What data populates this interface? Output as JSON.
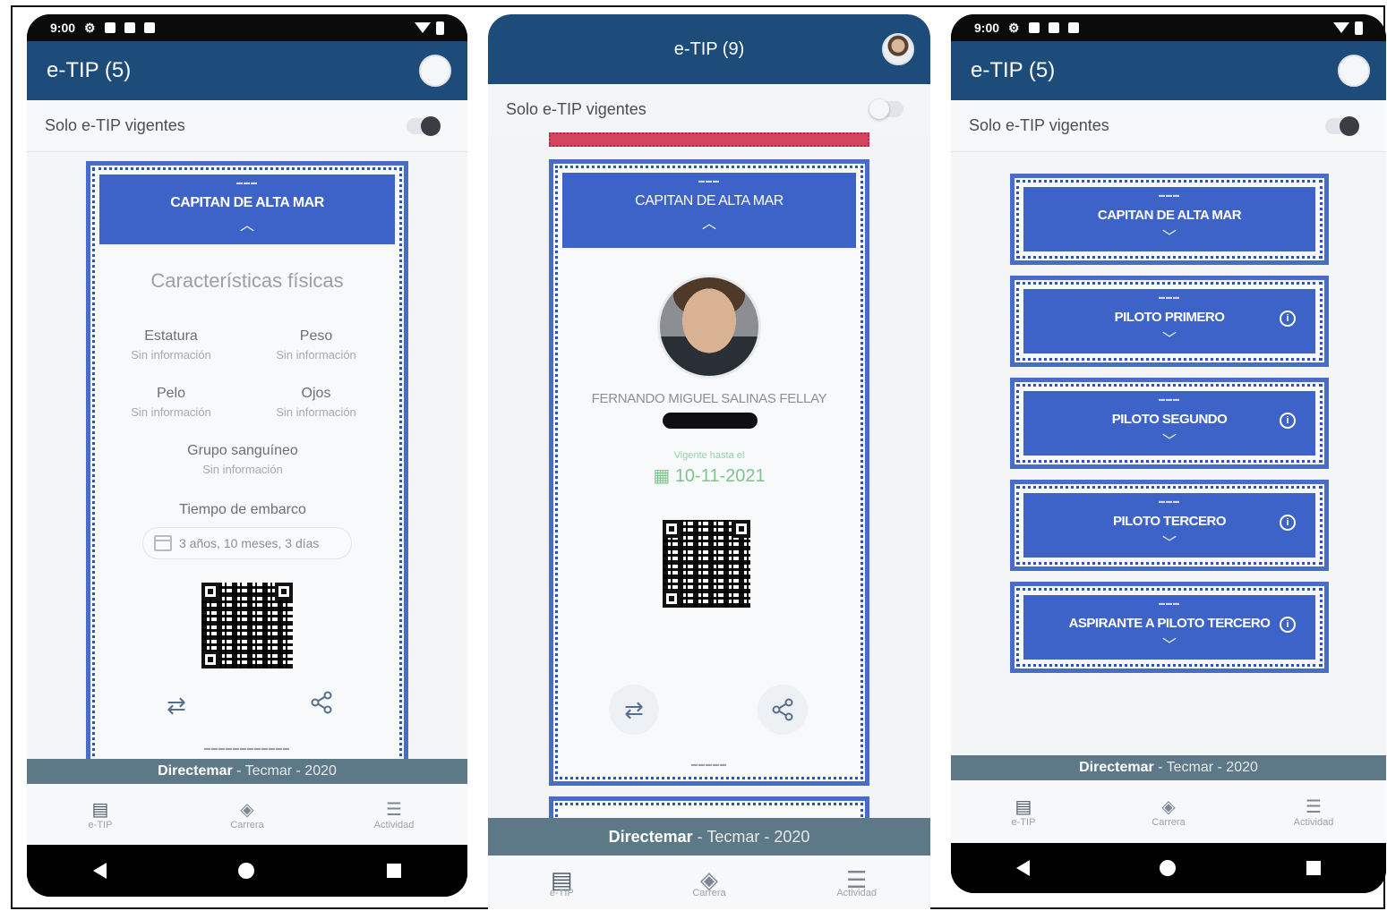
{
  "phone1": {
    "status_time": "9:00",
    "app_title": "e-TIP (5)",
    "filter_label": "Solo e-TIP vigentes",
    "card": {
      "rank": "CAPITAN DE ALTA MAR",
      "section_title": "Características físicas",
      "attributes": [
        {
          "label": "Estatura",
          "value": "Sin información"
        },
        {
          "label": "Peso",
          "value": "Sin información"
        },
        {
          "label": "Pelo",
          "value": "Sin información"
        },
        {
          "label": "Ojos",
          "value": "Sin información"
        }
      ],
      "blood_label": "Grupo sanguíneo",
      "blood_value": "Sin información",
      "embark_label": "Tiempo de embarco",
      "embark_value": "3 años, 10 meses, 3 días"
    },
    "footer": {
      "brand": "Directemar",
      "rest": " - Tecmar - 2020"
    },
    "tabs": [
      {
        "label": "e-TIP",
        "icon": "card-icon"
      },
      {
        "label": "Carrera",
        "icon": "layers-icon"
      },
      {
        "label": "Actividad",
        "icon": "stack-icon"
      }
    ]
  },
  "phone2": {
    "app_title": "e-TIP (9)",
    "filter_label": "Solo e-TIP vigentes",
    "card": {
      "rank": "CAPITAN DE ALTA MAR",
      "holder_name": "FERNANDO MIGUEL SALINAS FELLAY",
      "valid_label": "Vigente hasta el",
      "valid_date": "10-11-2021"
    },
    "footer": {
      "brand": "Directemar",
      "rest": " - Tecmar - 2020"
    },
    "tabs": [
      {
        "label": "e-TIP",
        "icon": "card-icon"
      },
      {
        "label": "Carrera",
        "icon": "layers-icon"
      },
      {
        "label": "Actividad",
        "icon": "stack-icon"
      }
    ]
  },
  "phone3": {
    "status_time": "9:00",
    "app_title": "e-TIP (5)",
    "filter_label": "Solo e-TIP vigentes",
    "cards": [
      {
        "rank": "CAPITAN DE ALTA MAR"
      },
      {
        "rank": "PILOTO PRIMERO"
      },
      {
        "rank": "PILOTO SEGUNDO"
      },
      {
        "rank": "PILOTO TERCERO"
      },
      {
        "rank": "ASPIRANTE A PILOTO TERCERO"
      }
    ],
    "footer": {
      "brand": "Directemar",
      "rest": " - Tecmar - 2020"
    },
    "tabs": [
      {
        "label": "e-TIP",
        "icon": "card-icon"
      },
      {
        "label": "Carrera",
        "icon": "layers-icon"
      },
      {
        "label": "Actividad",
        "icon": "stack-icon"
      }
    ]
  },
  "icons": {
    "transfer": "⇄",
    "share": "share-icon",
    "chevron_up": "︿",
    "chevron_down": "﹀",
    "info": "i"
  }
}
